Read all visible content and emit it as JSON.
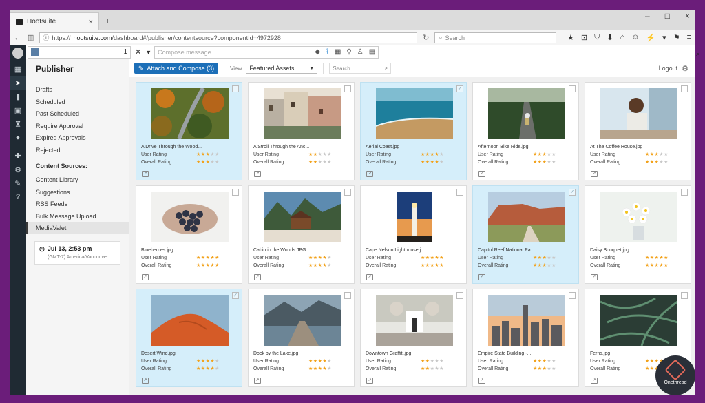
{
  "browser": {
    "tab_title": "Hootsuite",
    "tab_close": "×",
    "new_tab": "+",
    "win_controls": [
      "–",
      "□",
      "×"
    ],
    "url_prefix": "https://",
    "url_domain": "hootsuite.com",
    "url_path": "/dashboard#/publisher/contentsource?componentId=4972928",
    "search_placeholder": "Search",
    "toolbar_icons": [
      "★",
      "⊡",
      "⛉",
      "⬇",
      "⌂",
      "☺",
      "⚡",
      "▾",
      "⚑",
      "≡"
    ]
  },
  "compose": {
    "profile_count": "1",
    "placeholder": "Compose message..."
  },
  "iconbar": {
    "icons": [
      "streams-icon",
      "publisher-icon",
      "analytics-icon",
      "assignments-icon",
      "contests-icon",
      "contacts-icon",
      "apps-icon",
      "settings-icon",
      "tools-icon",
      "help-icon"
    ]
  },
  "sidebar": {
    "title": "Publisher",
    "items": [
      "Drafts",
      "Scheduled",
      "Past Scheduled",
      "Require Approval",
      "Expired Approvals",
      "Rejected"
    ],
    "content_heading": "Content Sources:",
    "sources": [
      "Content Library",
      "Suggestions",
      "RSS Feeds",
      "Bulk Message Upload",
      "MediaValet"
    ],
    "active_source": "MediaValet",
    "date": "Jul 13, 2:53 pm",
    "timezone": "(GMT-7) America/Vancouver"
  },
  "toolbar": {
    "attach_label": "Attach and Compose (3)",
    "view_label": "View",
    "view_value": "Featured Assets",
    "search_placeholder": "Search..",
    "logout": "Logout"
  },
  "labels": {
    "user_rating": "User Rating",
    "overall_rating": "Overall Rating"
  },
  "assets": [
    {
      "name": "A Drive Through the Wood...",
      "user": 3,
      "overall": 3,
      "selected": true,
      "checked": false,
      "img": "forest-road"
    },
    {
      "name": "A Stroll Through the Anc...",
      "user": 2,
      "overall": 2,
      "selected": false,
      "checked": false,
      "img": "old-town"
    },
    {
      "name": "Aerial Coast.jpg",
      "user": 4,
      "overall": 4,
      "selected": true,
      "checked": true,
      "img": "coast"
    },
    {
      "name": "Afternoon Bike Ride.jpg",
      "user": 3,
      "overall": 3,
      "selected": false,
      "checked": false,
      "img": "bike-road"
    },
    {
      "name": "At The Coffee House.jpg",
      "user": 3,
      "overall": 3,
      "selected": false,
      "checked": false,
      "img": "coffee"
    },
    {
      "name": "Blueberries.jpg",
      "user": 5,
      "overall": 5,
      "selected": false,
      "checked": false,
      "img": "berries"
    },
    {
      "name": "Cabin in the Woods.JPG",
      "user": 4,
      "overall": 4,
      "selected": false,
      "checked": false,
      "img": "cabin"
    },
    {
      "name": "Cape Nelson Lighthouse.j...",
      "user": 5,
      "overall": 5,
      "selected": false,
      "checked": false,
      "img": "lighthouse"
    },
    {
      "name": "Capitol Reef National Pa...",
      "user": 3,
      "overall": 3,
      "selected": true,
      "checked": true,
      "img": "canyon"
    },
    {
      "name": "Daisy Bouquet.jpg",
      "user": 5,
      "overall": 5,
      "selected": false,
      "checked": false,
      "img": "daisies"
    },
    {
      "name": "Desert Wind.jpg",
      "user": 4,
      "overall": 4,
      "selected": true,
      "checked": true,
      "img": "dunes"
    },
    {
      "name": "Dock by the Lake.jpg",
      "user": 4,
      "overall": 4,
      "selected": false,
      "checked": false,
      "img": "dock"
    },
    {
      "name": "Downtown Graffiti.jpg",
      "user": 2,
      "overall": 2,
      "selected": false,
      "checked": false,
      "img": "graffiti"
    },
    {
      "name": "Empire State Building -...",
      "user": 3,
      "overall": 3,
      "selected": false,
      "checked": false,
      "img": "city"
    },
    {
      "name": "Ferns.jpg",
      "user": 4,
      "overall": 4,
      "selected": false,
      "checked": false,
      "img": "ferns"
    }
  ],
  "badge": {
    "text": "Onethread"
  }
}
